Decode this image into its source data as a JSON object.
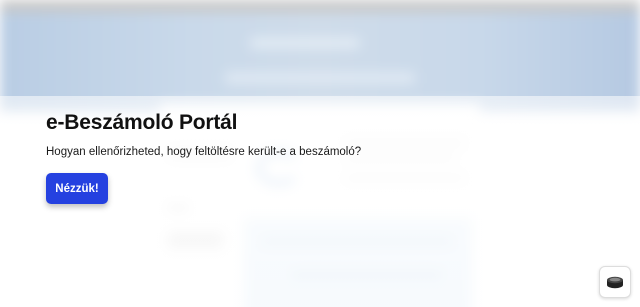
{
  "modal": {
    "title": "e-Beszámoló Portál",
    "subtitle": "Hogyan ellenőrizheted, hogy feltöltésre került-e a beszámoló?",
    "cta_label": "Nézzük!"
  },
  "floating_button": {
    "icon": "coin-stack-icon"
  },
  "colors": {
    "accent": "#2541e0",
    "banner": "#c9d9ea"
  }
}
